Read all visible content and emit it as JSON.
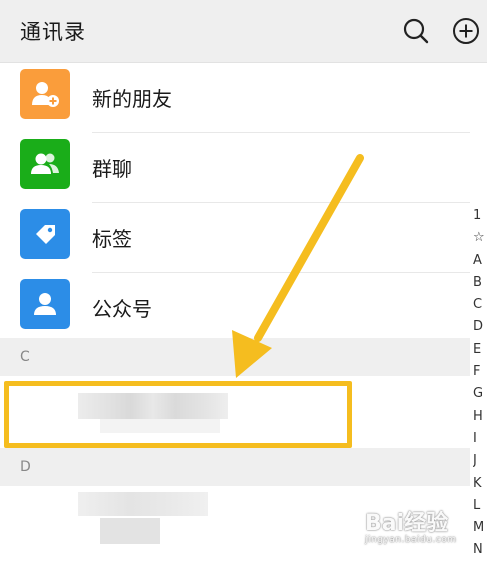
{
  "header": {
    "title": "通讯录",
    "search_icon": "search-icon",
    "add_icon": "plus-circle-icon"
  },
  "menu": [
    {
      "label": "新的朋友",
      "icon": "add-friend-icon",
      "color": "#fa9d3b"
    },
    {
      "label": "群聊",
      "icon": "group-chat-icon",
      "color": "#1aad19"
    },
    {
      "label": "标签",
      "icon": "tag-icon",
      "color": "#2c8de7"
    },
    {
      "label": "公众号",
      "icon": "official-account-icon",
      "color": "#2c8de7"
    }
  ],
  "sections": [
    {
      "letter": "C"
    },
    {
      "letter": "D"
    }
  ],
  "index": [
    "1",
    "☆",
    "A",
    "B",
    "C",
    "D",
    "E",
    "F",
    "G",
    "H",
    "I",
    "J",
    "K",
    "L",
    "M",
    "N"
  ],
  "colors": {
    "highlight": "#f5bd1f",
    "header_bg": "#efefef"
  },
  "watermark": {
    "brand": "Bai经验",
    "url": "jingyan.baidu.com"
  }
}
